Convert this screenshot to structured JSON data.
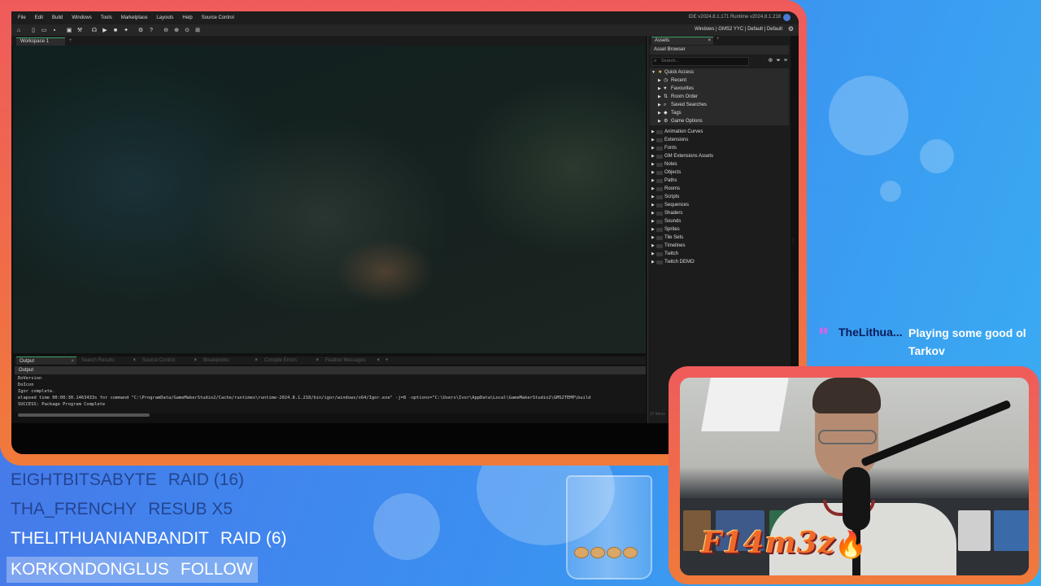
{
  "ide": {
    "menu": [
      "File",
      "Edit",
      "Build",
      "Windows",
      "Tools",
      "Marketplace",
      "Layouts",
      "Help",
      "Source Control"
    ],
    "version": "IDE v2024.8.1.171  Runtime v2024.8.1.218",
    "target": "Windows  |  GMS2 YYC  |  Default  |  Default",
    "workspace_tab": "Workspace 1",
    "output": {
      "tabs": [
        "Output",
        "Search Results",
        "Source Control",
        "Breakpoints",
        "Compile Errors",
        "Feather Messages"
      ],
      "header": "Output",
      "lines": [
        "DoVersion",
        "DoIcon",
        "Igor complete.",
        "elapsed time 00:00:30.1463433s for command \"C:\\ProgramData/GameMakerStudio2/Cache/runtimes\\runtime-2024.8.1.218/bin/igor/windows/x64/Igor.exe\" -j=8  -options=\"C:\\Users\\Ivor\\AppData\\Local\\GameMakerStudio2\\GMS2TEMP\\build",
        "SUCCESS: Package Program Complete"
      ]
    },
    "assets": {
      "tab": "Assets",
      "title": "Asset Browser",
      "search_placeholder": "Search...",
      "quick_access": {
        "label": "Quick Access",
        "items": [
          {
            "label": "Recent",
            "icon": "clock-icon"
          },
          {
            "label": "Favourites",
            "icon": "heart-icon"
          },
          {
            "label": "Room Order",
            "icon": "room-order-icon"
          },
          {
            "label": "Saved Searches",
            "icon": "search-icon"
          },
          {
            "label": "Tags",
            "icon": "tag-icon"
          },
          {
            "label": "Game Options",
            "icon": "gear-icon"
          }
        ]
      },
      "folders": [
        "Animation Curves",
        "Extensions",
        "Fonts",
        "GM Extensions Assets",
        "Notes",
        "Objects",
        "Paths",
        "Rooms",
        "Scripts",
        "Sequences",
        "Shaders",
        "Sounds",
        "Sprites",
        "Tile Sets",
        "Timelines",
        "Twitch",
        "Twitch DEMO"
      ],
      "count": "37 items"
    }
  },
  "chat": {
    "user": "TheLithua...",
    "message": "Playing some good ol Tarkov",
    "user_color": "#0c1b5c"
  },
  "camera": {
    "overlay_text": "F14m3z"
  },
  "events": [
    {
      "name": "EIGHTBITSABYTE",
      "action": "RAID (16)",
      "style": "dim"
    },
    {
      "name": "THA_FRENCHY",
      "action": "RESUB X5",
      "style": "dim"
    },
    {
      "name": "THELITHUANIANBANDIT",
      "action": "RAID (6)",
      "style": "bright"
    },
    {
      "name": "KORKONDONGLUS",
      "action": "FOLLOW",
      "style": "highlight"
    }
  ],
  "colors": {
    "frame_orange": "#f07a3a",
    "frame_red": "#ef5b5b",
    "background_blue": "#3b8ff0",
    "accent_green": "#3fa46a"
  }
}
